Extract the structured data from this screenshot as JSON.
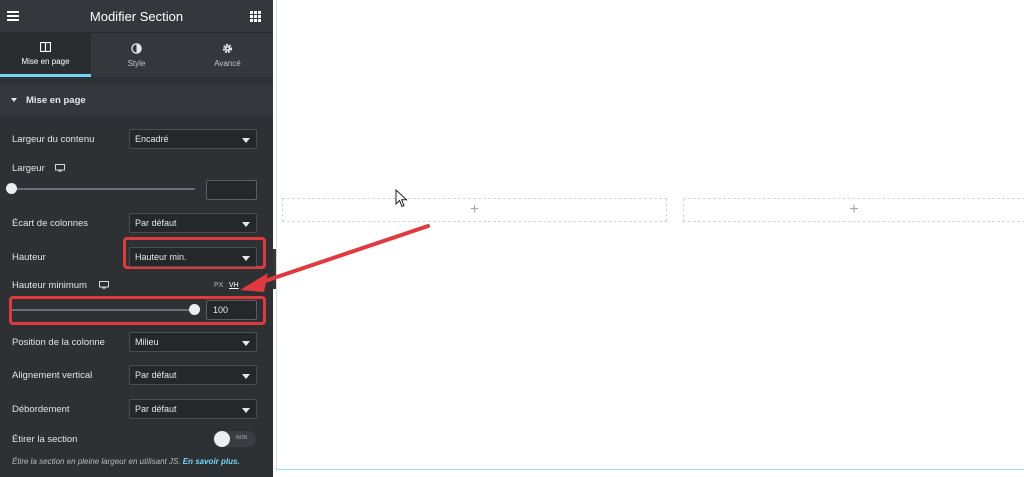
{
  "header": {
    "title": "Modifier Section",
    "menu_icon": "hamburger-icon",
    "apps_icon": "grid-icon"
  },
  "tabs": [
    {
      "label": "Mise en page",
      "icon": "columns-icon",
      "active": true
    },
    {
      "label": "Style",
      "icon": "half-circle-icon",
      "active": false
    },
    {
      "label": "Avancé",
      "icon": "gear-icon",
      "active": false
    }
  ],
  "section": {
    "title": "Mise en page"
  },
  "controls": {
    "content_width": {
      "label": "Largeur du contenu",
      "value": "Encadré"
    },
    "width": {
      "label": "Largeur",
      "value": "",
      "slider": 0
    },
    "column_gap": {
      "label": "Écart de colonnes",
      "value": "Par défaut"
    },
    "height": {
      "label": "Hauteur",
      "value": "Hauteur min."
    },
    "min_height": {
      "label": "Hauteur minimum",
      "value": "100",
      "unit_px": "PX",
      "unit_vh": "VH",
      "slider": 1.0
    },
    "column_position": {
      "label": "Position de la colonne",
      "value": "Milieu"
    },
    "vertical_align": {
      "label": "Alignement vertical",
      "value": "Par défaut"
    },
    "overflow": {
      "label": "Débordement",
      "value": "Par défaut"
    },
    "stretch": {
      "label": "Étirer la section",
      "toggle_text": "NON"
    }
  },
  "help": {
    "text": "Étire la section en pleine largeur en utilisant JS. ",
    "link": "En savoir plus."
  },
  "colors": {
    "panel_bg": "#2e3134",
    "accent": "#71d7f7",
    "highlight": "#e0393e"
  }
}
